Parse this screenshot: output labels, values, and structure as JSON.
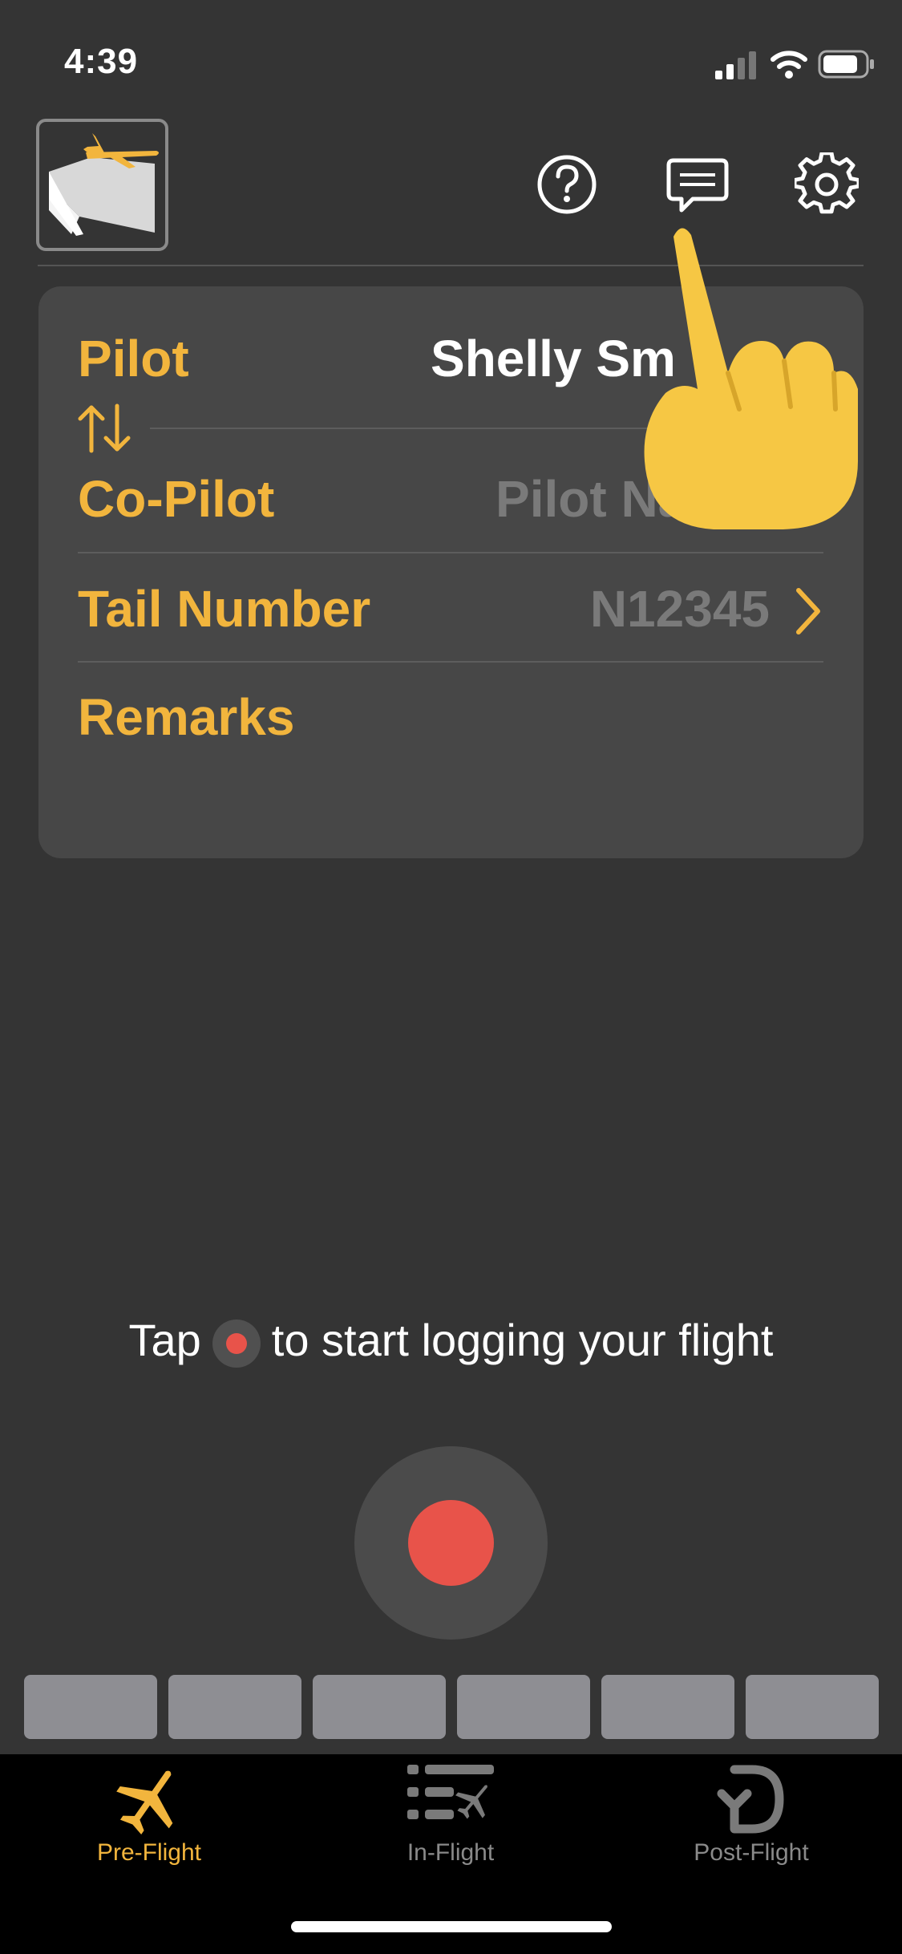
{
  "status_bar": {
    "time": "4:39"
  },
  "header": {
    "help_icon": "question-circle-icon",
    "feedback_icon": "speech-bubble-icon",
    "settings_icon": "gear-icon"
  },
  "card": {
    "pilot_label": "Pilot",
    "pilot_value": "Shelly Sm",
    "swap_icon": "swap-arrows-icon",
    "copilot_label": "Co-Pilot",
    "copilot_value": "Pilot Na",
    "tail_label": "Tail Number",
    "tail_value": "N12345",
    "remarks_label": "Remarks"
  },
  "prompt": {
    "before": "Tap",
    "after": "to start logging your flight"
  },
  "tabs": [
    {
      "label": "Pre-Flight",
      "icon": "airplane-icon",
      "active": true
    },
    {
      "label": "In-Flight",
      "icon": "list-airplane-icon",
      "active": false
    },
    {
      "label": "Post-Flight",
      "icon": "return-d-icon",
      "active": false
    }
  ],
  "colors": {
    "accent": "#f2b53d",
    "record": "#e8534a",
    "background": "#343434",
    "card": "#474747"
  }
}
